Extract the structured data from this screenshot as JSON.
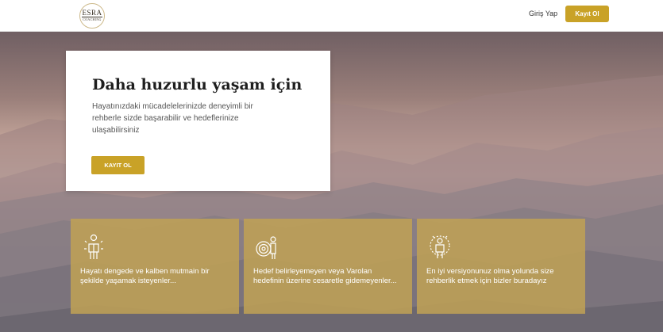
{
  "header": {
    "logo_line1": "ESRA",
    "logo_line2": "COACHING",
    "login_label": "Giriş Yap",
    "signup_label": "Kayıt Ol"
  },
  "hero": {
    "title": "Daha huzurlu yaşam için",
    "subtitle": "Hayatınızdaki mücadelelerinizde deneyimli bir rehberle sizde başarabilir ve hedeflerinize ulaşabilirsiniz",
    "cta_label": "KAYIT OL"
  },
  "features": [
    {
      "icon": "balance-person-icon",
      "text": "Hayatı dengede ve kalben mutmain bir şekilde yaşamak isteyenler..."
    },
    {
      "icon": "target-person-icon",
      "text": "Hedef belirleyemeyen veya Varolan hedefinin üzerine cesaretle gidemeyenler..."
    },
    {
      "icon": "growth-person-icon",
      "text": "En iyi versiyonunuz olma yolunda size rehberlik etmek için bizler buradayız"
    }
  ],
  "colors": {
    "accent": "#c9a227",
    "card_overlay": "#bea055"
  }
}
